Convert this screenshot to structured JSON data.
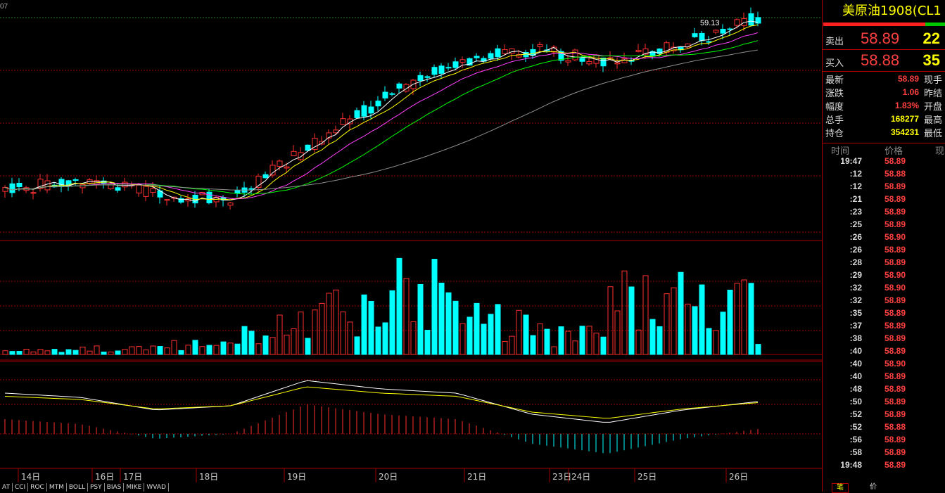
{
  "instrument": {
    "title": "美原油1908(CL1"
  },
  "top_left_label": "07",
  "peak_label": "59.13",
  "quotes": {
    "sell": {
      "label": "卖出",
      "price": "58.89",
      "volume": "22"
    },
    "buy": {
      "label": "买入",
      "price": "58.88",
      "volume": "35"
    }
  },
  "stats": [
    {
      "key": "最新",
      "value": "58.89",
      "color": "#ff4040",
      "key2": "现手"
    },
    {
      "key": "涨跌",
      "value": "1.06",
      "color": "#ff4040",
      "key2": "昨结"
    },
    {
      "key": "幅度",
      "value": "1.83%",
      "color": "#ff4040",
      "key2": "开盘"
    },
    {
      "key": "总手",
      "value": "168277",
      "color": "#ffff00",
      "key2": "最高"
    },
    {
      "key": "持仓",
      "value": "354231",
      "color": "#ffff00",
      "key2": "最低"
    }
  ],
  "tick_header": {
    "time": "时间",
    "price": "价格",
    "vol": "现"
  },
  "ticks": [
    {
      "t": "19:47",
      "p": "58.89"
    },
    {
      "t": ":12",
      "p": "58.88"
    },
    {
      "t": ":12",
      "p": "58.89"
    },
    {
      "t": ":21",
      "p": "58.89"
    },
    {
      "t": ":23",
      "p": "58.89"
    },
    {
      "t": ":25",
      "p": "58.89"
    },
    {
      "t": ":26",
      "p": "58.90"
    },
    {
      "t": ":26",
      "p": "58.89"
    },
    {
      "t": ":28",
      "p": "58.89"
    },
    {
      "t": ":29",
      "p": "58.90"
    },
    {
      "t": ":32",
      "p": "58.90"
    },
    {
      "t": ":32",
      "p": "58.89"
    },
    {
      "t": ":35",
      "p": "58.89"
    },
    {
      "t": ":37",
      "p": "58.89"
    },
    {
      "t": ":38",
      "p": "58.89"
    },
    {
      "t": ":40",
      "p": "58.89"
    },
    {
      "t": ":40",
      "p": "58.90"
    },
    {
      "t": ":40",
      "p": "58.89"
    },
    {
      "t": ":48",
      "p": "58.89"
    },
    {
      "t": ":50",
      "p": "58.89"
    },
    {
      "t": ":52",
      "p": "58.89"
    },
    {
      "t": ":52",
      "p": "58.88"
    },
    {
      "t": ":56",
      "p": "58.89"
    },
    {
      "t": ":58",
      "p": "58.89"
    },
    {
      "t": "19:48",
      "p": "58.89"
    }
  ],
  "date_labels": [
    "14日",
    "16日",
    "17日",
    "18日",
    "19日",
    "20日",
    "21日",
    "23日",
    "24日",
    "25日",
    "26日"
  ],
  "indicator_tabs": [
    "AT",
    "CCI",
    "ROC",
    "MTM",
    "BOLL",
    "PSY",
    "BIAS",
    "MIKE",
    "WVAD"
  ],
  "right_tabs": [
    "笔",
    "价"
  ],
  "colors": {
    "up": "#ff3030",
    "down": "#00ffff",
    "ma1": "#ffffff",
    "ma2": "#ffff00",
    "ma3": "#ff40ff",
    "ma4": "#00ff00",
    "ma5": "#909090",
    "grid": "#a00000"
  },
  "chart_data": {
    "type": "candlestick",
    "ylim": [
      55.2,
      59.13
    ],
    "x": [
      "14日",
      "16日",
      "17日",
      "18日",
      "19日",
      "20日",
      "21日",
      "23日",
      "24日",
      "25日",
      "26日"
    ],
    "candles_approx_close_by_day": [
      56.0,
      56.1,
      55.9,
      55.8,
      56.7,
      57.6,
      58.3,
      58.5,
      58.3,
      58.6,
      59.1
    ],
    "volume_relative_by_day": [
      0.05,
      0.08,
      0.15,
      0.4,
      0.6,
      0.9,
      0.5,
      0.3,
      0.8,
      0.7,
      0.2
    ],
    "macd_hist_relative_by_day": [
      0.3,
      0.2,
      -0.1,
      0.0,
      0.6,
      0.4,
      0.3,
      -0.2,
      -0.4,
      -0.1,
      0.1
    ]
  }
}
